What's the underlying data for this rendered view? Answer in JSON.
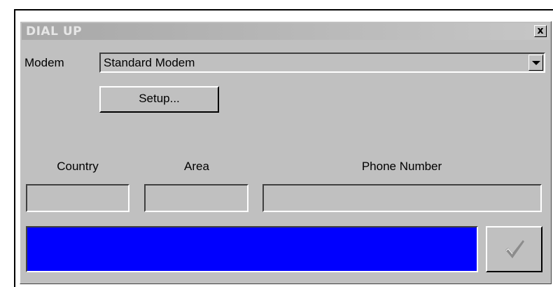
{
  "window": {
    "title": "DIAL UP",
    "close_glyph": "x"
  },
  "modem": {
    "label": "Modem",
    "selected": "Standard Modem",
    "setup_label": "Setup..."
  },
  "phone": {
    "country_label": "Country",
    "area_label": "Area",
    "number_label": "Phone Number",
    "country_value": "",
    "area_value": "",
    "number_value": ""
  },
  "status": {
    "bar_color": "#0000ff"
  },
  "ok_button": {
    "icon": "checkmark-icon"
  }
}
